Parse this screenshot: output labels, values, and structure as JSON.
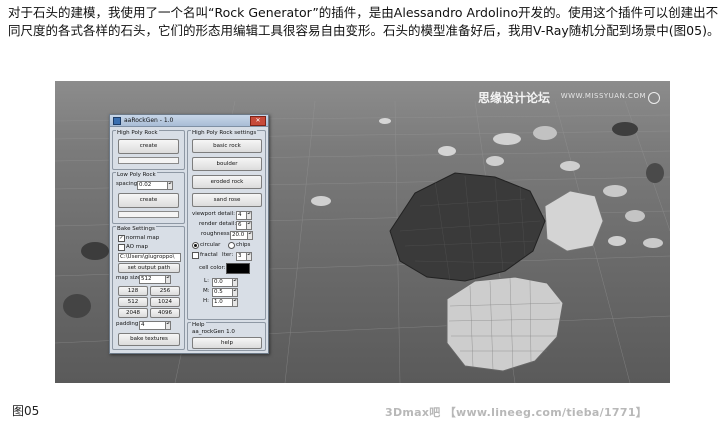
{
  "article": {
    "intro": "对于石头的建模，我使用了一个名叫“Rock Generator”的插件，是由Alessandro Ardolino开发的。使用这个插件可以创建出不同尺度的各式各样的石头，它们的形态用编辑工具很容易自由变形。石头的模型准备好后，我用V-Ray随机分配到场景中(图05)。",
    "caption": "图05",
    "footer_watermark": "3Dmax吧 【www.lineeg.com/tieba/1771】"
  },
  "scene": {
    "watermark_cn": "思缘设计论坛",
    "watermark_site": "WWW.MISSYUAN.COM",
    "colors": {
      "background": "#7a7a7a",
      "grid": "#9a9a9a",
      "rock_dark": "#3a3a3a",
      "rock_light": "#cfcfcf"
    }
  },
  "dialog": {
    "title": "aaRockGen - 1.0",
    "close_icon": "close-icon",
    "high_poly": {
      "title": "High Poly Rock",
      "create": "create"
    },
    "low_poly": {
      "title": "Low Poly Rock",
      "spacing_label": "spacing:",
      "spacing_value": "0.02",
      "create": "create"
    },
    "bake": {
      "title": "Bake Settings",
      "normal_map": "normal map",
      "ao_map": "AO map",
      "path_value": "C:\\Users\\giugroppo\\",
      "set_output_path": "set output path",
      "map_size_label": "map size:",
      "map_size_value": "512",
      "sizes": [
        "128",
        "256",
        "512",
        "1024",
        "2048",
        "4096"
      ],
      "padding_label": "padding:",
      "padding_value": "4",
      "bake_textures": "bake textures"
    },
    "high_poly_settings": {
      "title": "High Poly Rock settings",
      "presets": [
        "basic rock",
        "boulder",
        "eroded rock",
        "sand rose"
      ],
      "viewport_detail_label": "viewport detail:",
      "viewport_detail_value": "4",
      "render_detail_label": "render detail:",
      "render_detail_value": "6",
      "roughness_label": "roughness:",
      "roughness_value": "20.0",
      "circular": "circular",
      "chips": "chips",
      "fractal_label": "fractal",
      "iter_label": "Iter:",
      "iter_value": "3",
      "cell_color_label": "cell color:",
      "L_label": "L:",
      "L_value": "0.0",
      "M_label": "M:",
      "M_value": "0.5",
      "H_label": "H:",
      "H_value": "1.0"
    },
    "help": {
      "title": "Help",
      "about": "aa_rockGen 1.0",
      "button": "help"
    }
  }
}
